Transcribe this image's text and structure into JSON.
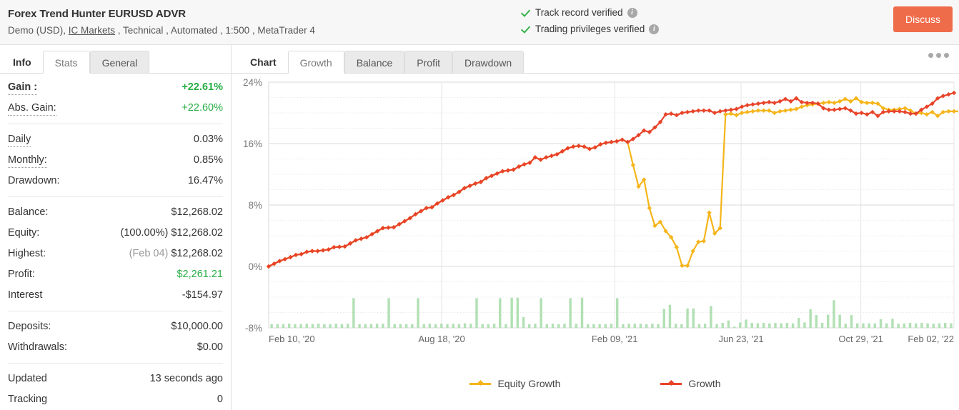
{
  "header": {
    "account_title": "Forex Trend Hunter EURUSD ADVR",
    "account_meta_prefix": "Demo (USD), ",
    "broker_link": "IC Markets",
    "account_meta_suffix": " , Technical , Automated , 1:500 , MetaTrader 4",
    "verifications": [
      {
        "label": "Track record verified",
        "info": "i"
      },
      {
        "label": "Trading privileges verified",
        "info": "i"
      }
    ],
    "discuss_label": "Discuss",
    "accent_color": "#ef6c4a",
    "verified_color": "#36b34b"
  },
  "sidebar": {
    "tabs": [
      {
        "label": "Info",
        "state": "bare"
      },
      {
        "label": "Stats",
        "state": "active"
      },
      {
        "label": "General",
        "state": "inactive"
      }
    ],
    "groups": [
      {
        "rows": [
          {
            "label": "Gain :",
            "value": "+22.61%",
            "label_bold": true,
            "label_dotted": true,
            "value_green": true,
            "value_bold": true
          },
          {
            "label": "Abs. Gain:",
            "value": "+22.60%",
            "label_dotted": true,
            "value_green": true
          }
        ]
      },
      {
        "rows": [
          {
            "label": "Daily",
            "value": "0.03%",
            "label_dotted": true
          },
          {
            "label": "Monthly:",
            "value": "0.85%",
            "label_dotted": true
          },
          {
            "label": "Drawdown:",
            "value": "16.47%"
          }
        ]
      },
      {
        "rows": [
          {
            "label": "Balance:",
            "value": "$12,268.02"
          },
          {
            "label": "Equity:",
            "prefix": "(100.00%) ",
            "value": "$12,268.02"
          },
          {
            "label": "Highest:",
            "prefix": "(Feb 04) ",
            "prefix_muted": true,
            "value": "$12,268.02"
          },
          {
            "label": "Profit:",
            "value": "$2,261.21",
            "value_green": true
          },
          {
            "label": "Interest",
            "value": "-$154.97"
          }
        ]
      },
      {
        "rows": [
          {
            "label": "Deposits:",
            "value": "$10,000.00"
          },
          {
            "label": "Withdrawals:",
            "value": "$0.00"
          }
        ]
      },
      {
        "rows": [
          {
            "label": "Updated",
            "value": "13 seconds ago"
          },
          {
            "label": "Tracking",
            "value": "0"
          }
        ]
      }
    ]
  },
  "chart_panel": {
    "tabs": [
      {
        "label": "Chart",
        "state": "bare"
      },
      {
        "label": "Growth",
        "state": "active"
      },
      {
        "label": "Balance",
        "state": "inactive"
      },
      {
        "label": "Profit",
        "state": "inactive"
      },
      {
        "label": "Drawdown",
        "state": "inactive"
      }
    ],
    "menu_icon": "more-options-icon"
  },
  "chart_data": {
    "type": "line",
    "title": "",
    "xlabel": "",
    "ylabel": "",
    "ylim": [
      -8,
      24
    ],
    "yticks": [
      24,
      16,
      8,
      0,
      -8
    ],
    "ytick_labels": [
      "24%",
      "16%",
      "8%",
      "0%",
      "-8%"
    ],
    "grid": true,
    "minor_grid": true,
    "legend_position": "bottom",
    "xticks": [
      0,
      26,
      52,
      71,
      89,
      103
    ],
    "xtick_labels": [
      "Feb 10, '20",
      "Aug 18, '20",
      "Feb 09, '21",
      "Jun 23, '21",
      "Oct 29, '21",
      "Feb 02, '22"
    ],
    "series": [
      {
        "name": "Growth",
        "color": "#e8442a",
        "values": [
          0.0,
          0.35,
          0.7,
          0.95,
          1.2,
          1.5,
          1.6,
          1.9,
          2.0,
          2.0,
          2.1,
          2.2,
          2.5,
          2.55,
          2.6,
          3.0,
          3.4,
          3.6,
          3.8,
          4.2,
          4.6,
          5.0,
          5.05,
          5.1,
          5.5,
          5.9,
          6.3,
          6.8,
          7.2,
          7.6,
          7.7,
          8.2,
          8.6,
          9.0,
          9.3,
          9.7,
          10.2,
          10.5,
          10.8,
          11.0,
          11.5,
          11.8,
          12.1,
          12.4,
          12.5,
          12.6,
          13.0,
          13.3,
          13.5,
          14.2,
          13.9,
          14.2,
          14.4,
          14.6,
          15.0,
          15.4,
          15.6,
          15.7,
          15.6,
          15.3,
          15.5,
          15.9,
          16.1,
          16.2,
          16.3,
          16.5,
          16.2,
          16.6,
          17.1,
          17.7,
          17.5,
          18.1,
          18.8,
          19.8,
          19.9,
          19.7,
          20.0,
          20.1,
          20.2,
          20.3,
          20.3,
          20.3,
          20.0,
          20.2,
          20.3,
          20.4,
          20.5,
          20.8,
          21.0,
          21.1,
          21.2,
          21.3,
          21.4,
          21.3,
          21.5,
          21.8,
          21.5,
          21.9,
          21.4,
          21.3,
          21.3,
          21.2,
          20.6,
          20.4,
          20.4,
          20.5,
          20.6,
          20.3,
          19.9,
          20.0,
          19.8,
          20.1,
          19.6,
          20.1,
          20.2,
          20.2,
          20.2,
          20.1,
          19.9,
          19.9,
          20.4,
          20.8,
          21.2,
          21.9,
          22.2,
          22.4,
          22.6
        ],
        "marker": "diamond"
      },
      {
        "name": "Equity Growth",
        "color": "#f5b51a",
        "note": "Overlaps Growth except during the drawdown from index 66 to 89 where it dips to ~0%",
        "values": [
          0.0,
          0.35,
          0.7,
          0.95,
          1.2,
          1.5,
          1.6,
          1.9,
          2.0,
          2.0,
          2.1,
          2.2,
          2.5,
          2.55,
          2.6,
          3.0,
          3.4,
          3.6,
          3.8,
          4.2,
          4.6,
          5.0,
          5.05,
          5.1,
          5.5,
          5.9,
          6.3,
          6.8,
          7.2,
          7.6,
          7.7,
          8.2,
          8.6,
          9.0,
          9.3,
          9.7,
          10.2,
          10.5,
          10.8,
          11.0,
          11.5,
          11.8,
          12.1,
          12.4,
          12.5,
          12.6,
          13.0,
          13.3,
          13.5,
          14.2,
          13.9,
          14.2,
          14.4,
          14.6,
          15.0,
          15.4,
          15.6,
          15.7,
          15.6,
          15.3,
          15.5,
          15.9,
          16.1,
          16.2,
          16.3,
          16.5,
          16.2,
          13.2,
          10.4,
          11.3,
          7.6,
          5.3,
          5.8,
          4.6,
          3.8,
          2.5,
          0.1,
          0.1,
          2.0,
          3.2,
          3.3,
          7.0,
          4.3,
          5.0,
          19.8,
          19.9,
          19.7,
          20.0,
          20.1,
          20.2,
          20.3,
          20.3,
          20.3,
          20.0,
          20.2,
          20.3,
          20.4,
          20.5,
          20.8,
          21.0,
          21.1,
          21.2,
          21.3,
          21.4,
          21.3,
          21.5,
          21.8,
          21.5,
          21.9,
          21.4,
          21.3,
          21.3,
          21.2,
          20.6,
          20.4,
          20.4,
          20.5,
          20.6,
          20.3,
          19.9,
          20.0,
          19.8,
          20.1,
          19.6,
          20.1,
          20.2,
          20.2,
          20.2,
          20.1,
          19.9,
          19.9,
          20.4,
          20.8,
          21.2,
          21.9,
          22.2,
          22.4,
          22.6
        ],
        "marker": "diamond"
      }
    ],
    "bars": {
      "name": "Trading Volume",
      "color": "#b2e0b4",
      "baseline": -8,
      "max_height_pct": 9,
      "values": [
        0.9,
        0.9,
        0.9,
        1.0,
        0.9,
        0.9,
        1.0,
        0.9,
        1.0,
        0.9,
        0.9,
        1.0,
        0.9,
        1.0,
        7.2,
        0.9,
        0.9,
        0.9,
        1.0,
        1.0,
        7.2,
        0.9,
        0.9,
        0.9,
        0.9,
        7.2,
        0.9,
        1.0,
        0.9,
        1.0,
        0.9,
        1.0,
        0.9,
        1.1,
        1.0,
        7.2,
        0.9,
        0.9,
        1.0,
        7.2,
        0.9,
        7.3,
        7.3,
        2.6,
        0.9,
        1.0,
        7.2,
        0.9,
        1.0,
        0.9,
        1.0,
        7.2,
        1.0,
        7.3,
        0.9,
        0.9,
        0.9,
        0.9,
        1.0,
        7.2,
        0.9,
        1.0,
        1.0,
        1.0,
        0.9,
        1.0,
        0.9,
        4.6,
        5.6,
        1.0,
        0.9,
        4.7,
        4.7,
        0.9,
        1.0,
        5.3,
        0.9,
        1.2,
        1.8,
        0.3,
        1.3,
        2.0,
        1.2,
        1.1,
        1.2,
        1.1,
        1.2,
        1.1,
        1.2,
        1.1,
        2.4,
        1.3,
        4.5,
        3.1,
        1.2,
        3.2,
        6.7,
        3.2,
        1.0,
        3.1,
        1.1,
        1.1,
        1.1,
        1.1,
        2.1,
        1.1,
        2.2,
        1.0,
        1.1,
        1.2,
        1.1,
        1.2,
        1.1,
        1.0,
        1.1,
        1.2,
        1.1
      ]
    }
  }
}
